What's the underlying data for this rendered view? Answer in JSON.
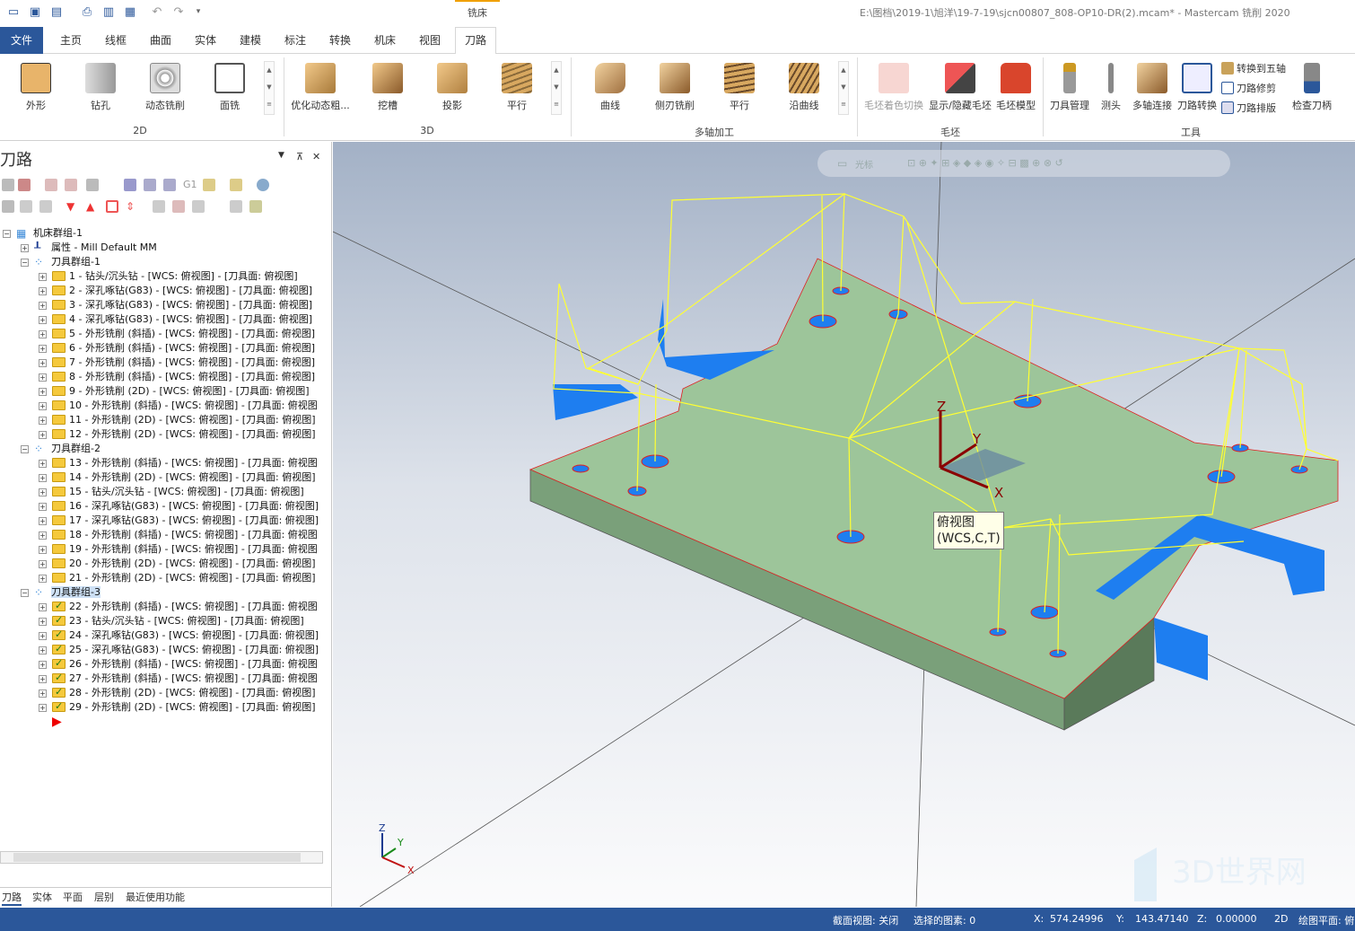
{
  "window": {
    "title": "E:\\图档\\2019-1\\旭洋\\19-7-19\\sjcn00807_808-OP10-DR(2).mcam* - Mastercam 铣削 2020",
    "context_tab": "铣床"
  },
  "menu": {
    "tabs": [
      "文件",
      "主页",
      "线框",
      "曲面",
      "实体",
      "建模",
      "标注",
      "转换",
      "机床",
      "视图",
      "刀路"
    ]
  },
  "ribbon": {
    "group_2d": {
      "label": "2D",
      "buttons": [
        "外形",
        "钻孔",
        "动态铣削",
        "面铣"
      ]
    },
    "group_3d": {
      "label": "3D",
      "buttons": [
        "优化动态粗...",
        "挖槽",
        "投影",
        "平行"
      ]
    },
    "group_multi": {
      "label": "多轴加工",
      "buttons": [
        "曲线",
        "侧刃铣削",
        "平行",
        "沿曲线"
      ]
    },
    "group_stock": {
      "label": "毛坯",
      "buttons": [
        "毛坯着色切换",
        "显示/隐藏毛坯",
        "毛坯模型"
      ]
    },
    "group_tools": {
      "label": "工具",
      "buttons": [
        "刀具管理",
        "测头",
        "多轴连接",
        "刀路转换"
      ],
      "small": [
        "转换到五轴",
        "刀路修剪",
        "刀路排版"
      ],
      "extra": "检查刀柄"
    }
  },
  "panel": {
    "title": "刀路",
    "pin": "⊼",
    "close": "✕",
    "tree": [
      {
        "level": 0,
        "type": "machine",
        "label": "机床群组-1"
      },
      {
        "level": 1,
        "type": "prop",
        "label": "属性 - Mill Default MM"
      },
      {
        "level": 1,
        "type": "group",
        "label": "刀具群组-1"
      },
      {
        "level": 2,
        "type": "op",
        "label": "1 - 钻头/沉头钻 - [WCS: 俯视图] - [刀具面: 俯视图]"
      },
      {
        "level": 2,
        "type": "op",
        "label": "2 - 深孔啄钻(G83) - [WCS: 俯视图] - [刀具面: 俯视图]"
      },
      {
        "level": 2,
        "type": "op",
        "label": "3 - 深孔啄钻(G83) - [WCS: 俯视图] - [刀具面: 俯视图]"
      },
      {
        "level": 2,
        "type": "op",
        "label": "4 - 深孔啄钻(G83) - [WCS: 俯视图] - [刀具面: 俯视图]"
      },
      {
        "level": 2,
        "type": "op",
        "label": "5 - 外形铣削 (斜插) - [WCS: 俯视图] - [刀具面: 俯视图]"
      },
      {
        "level": 2,
        "type": "op",
        "label": "6 - 外形铣削 (斜插) - [WCS: 俯视图] - [刀具面: 俯视图]"
      },
      {
        "level": 2,
        "type": "op",
        "label": "7 - 外形铣削 (斜插) - [WCS: 俯视图] - [刀具面: 俯视图]"
      },
      {
        "level": 2,
        "type": "op",
        "label": "8 - 外形铣削 (斜插) - [WCS: 俯视图] - [刀具面: 俯视图]"
      },
      {
        "level": 2,
        "type": "op",
        "label": "9 - 外形铣削 (2D) - [WCS: 俯视图] - [刀具面: 俯视图]"
      },
      {
        "level": 2,
        "type": "op",
        "label": "10 - 外形铣削 (斜插) - [WCS: 俯视图] - [刀具面: 俯视图"
      },
      {
        "level": 2,
        "type": "op",
        "label": "11 - 外形铣削 (2D) - [WCS: 俯视图] - [刀具面: 俯视图]"
      },
      {
        "level": 2,
        "type": "op",
        "label": "12 - 外形铣削 (2D) - [WCS: 俯视图] - [刀具面: 俯视图]"
      },
      {
        "level": 1,
        "type": "group",
        "label": "刀具群组-2"
      },
      {
        "level": 2,
        "type": "op",
        "label": "13 - 外形铣削 (斜插) - [WCS: 俯视图] - [刀具面: 俯视图"
      },
      {
        "level": 2,
        "type": "op",
        "label": "14 - 外形铣削 (2D) - [WCS: 俯视图] - [刀具面: 俯视图]"
      },
      {
        "level": 2,
        "type": "op",
        "label": "15 - 钻头/沉头钻 - [WCS: 俯视图] - [刀具面: 俯视图]"
      },
      {
        "level": 2,
        "type": "op",
        "label": "16 - 深孔啄钻(G83) - [WCS: 俯视图] - [刀具面: 俯视图]"
      },
      {
        "level": 2,
        "type": "op",
        "label": "17 - 深孔啄钻(G83) - [WCS: 俯视图] - [刀具面: 俯视图]"
      },
      {
        "level": 2,
        "type": "op",
        "label": "18 - 外形铣削 (斜插) - [WCS: 俯视图] - [刀具面: 俯视图"
      },
      {
        "level": 2,
        "type": "op",
        "label": "19 - 外形铣削 (斜插) - [WCS: 俯视图] - [刀具面: 俯视图"
      },
      {
        "level": 2,
        "type": "op",
        "label": "20 - 外形铣削 (2D) - [WCS: 俯视图] - [刀具面: 俯视图]"
      },
      {
        "level": 2,
        "type": "op",
        "label": "21 - 外形铣削 (2D) - [WCS: 俯视图] - [刀具面: 俯视图]"
      },
      {
        "level": 1,
        "type": "group",
        "label": "刀具群组-3"
      },
      {
        "level": 2,
        "type": "opc",
        "label": "22 - 外形铣削 (斜插) - [WCS: 俯视图] - [刀具面: 俯视图"
      },
      {
        "level": 2,
        "type": "opc",
        "label": "23 - 钻头/沉头钻 - [WCS: 俯视图] - [刀具面: 俯视图]"
      },
      {
        "level": 2,
        "type": "opc",
        "label": "24 - 深孔啄钻(G83) - [WCS: 俯视图] - [刀具面: 俯视图]"
      },
      {
        "level": 2,
        "type": "opc",
        "label": "25 - 深孔啄钻(G83) - [WCS: 俯视图] - [刀具面: 俯视图]"
      },
      {
        "level": 2,
        "type": "opc",
        "label": "26 - 外形铣削 (斜插) - [WCS: 俯视图] - [刀具面: 俯视图"
      },
      {
        "level": 2,
        "type": "opc",
        "label": "27 - 外形铣削 (斜插) - [WCS: 俯视图] - [刀具面: 俯视图"
      },
      {
        "level": 2,
        "type": "opc",
        "label": "28 - 外形铣削 (2D) - [WCS: 俯视图] - [刀具面: 俯视图]"
      },
      {
        "level": 2,
        "type": "opc",
        "label": "29 - 外形铣削 (2D) - [WCS: 俯视图] - [刀具面: 俯视图]"
      }
    ],
    "bottom_tabs": [
      "刀路",
      "实体",
      "平面",
      "层别",
      "最近使用功能"
    ]
  },
  "viewport": {
    "toolbar_label": "光标",
    "tooltip_line1": "俯视图",
    "tooltip_line2": "(WCS,C,T)",
    "axes": {
      "z": "Z",
      "y": "Y",
      "x": "X"
    },
    "mini_axes": {
      "z": "Z",
      "y": "Y",
      "x": "X"
    },
    "watermark": "3D世界网"
  },
  "status": {
    "section_view": "截面视图: 关闭",
    "selected": "选择的图素: 0",
    "x_label": "X:",
    "x_value": "574.24996",
    "y_label": "Y:",
    "y_value": "143.47140",
    "z_label": "Z:",
    "z_value": "0.00000",
    "mode": "2D",
    "plane": "绘图平面: 俯"
  },
  "colors": {
    "accent": "#2b579a",
    "part_top": "#9dc59a",
    "toolpath": "#ffff33",
    "cut": "#1e7ef0"
  }
}
